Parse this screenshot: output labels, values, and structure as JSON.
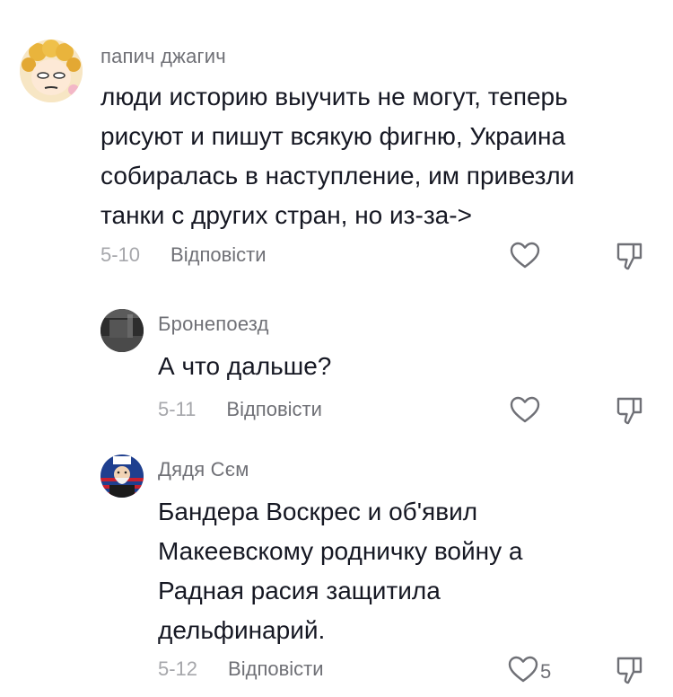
{
  "comments": [
    {
      "author": "папич джагич",
      "avatar_icon": "anime-character-avatar",
      "lines": [
        "люди историю выучить не могут, теперь",
        "рисуют и пишут всякую фигню, Украина",
        "собиралась в наступление, им привезли",
        "танки с других стран, но из-за->"
      ],
      "date": "5-10",
      "reply_label": "Відповісти",
      "like_count": ""
    },
    {
      "author": "Бронепоезд",
      "avatar_icon": "dark-photo-avatar",
      "lines": [
        "А что дальше?"
      ],
      "date": "5-11",
      "reply_label": "Відповісти",
      "like_count": ""
    },
    {
      "author": "Дядя Сєм",
      "avatar_icon": "uncle-sam-avatar",
      "lines": [
        "Бандера Воскрес и об'явил",
        "Макеевскому родничку войну а",
        "Радная расия защитила",
        "дельфинарий."
      ],
      "date": "5-12",
      "reply_label": "Відповісти",
      "like_count": "5"
    }
  ],
  "colors": {
    "text": "#161823",
    "secondary": "#6f7076",
    "date": "#a6a7ab"
  },
  "icons": {
    "like": "heart-outline-icon",
    "dislike": "thumbs-down-outline-icon"
  }
}
